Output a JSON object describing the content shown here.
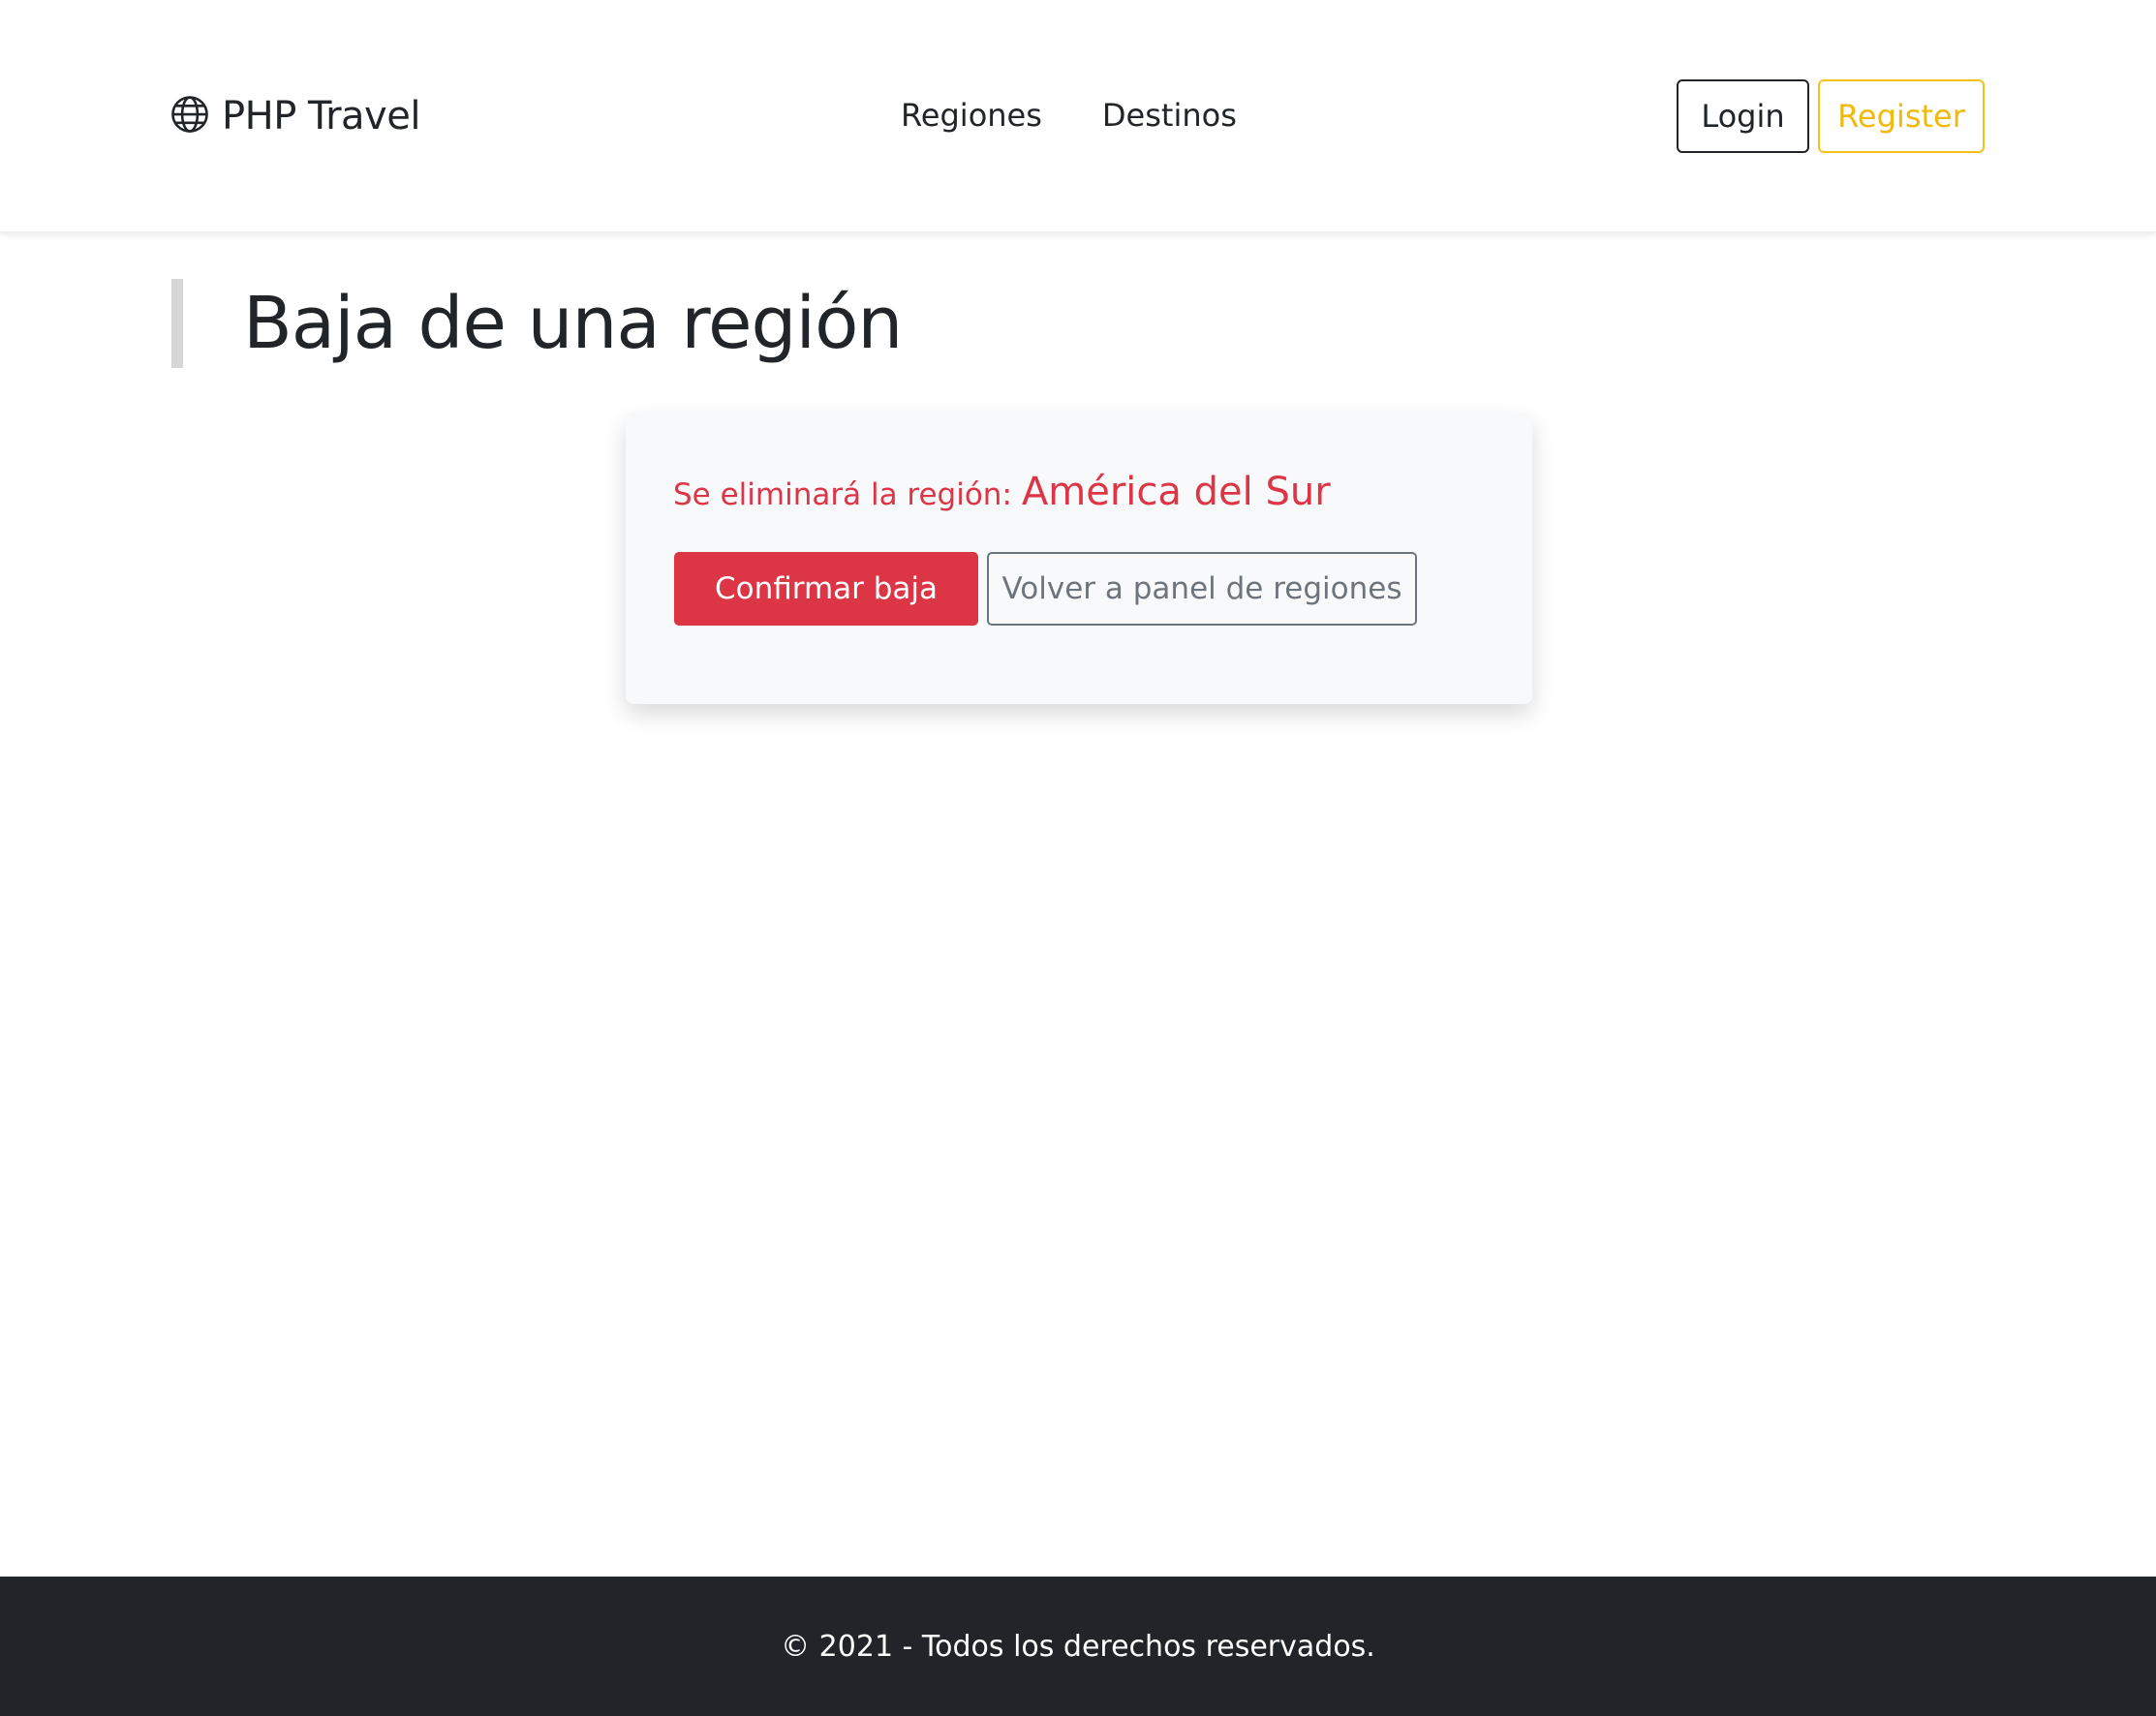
{
  "header": {
    "brand": "PHP Travel",
    "brand_icon": "globe-icon",
    "nav": [
      {
        "label": "Regiones"
      },
      {
        "label": "Destinos"
      }
    ],
    "login_label": "Login",
    "register_label": "Register"
  },
  "page": {
    "title": "Baja de una región"
  },
  "card": {
    "warning_label": "Se eliminará la región:",
    "region_name": "América del Sur",
    "confirm_label": "Confirmar baja",
    "back_label": "Volver a panel de regiones"
  },
  "footer": {
    "text": "© 2021 - Todos los derechos reservados."
  },
  "colors": {
    "danger": "#dc3545",
    "warning": "#f0b90b",
    "dark": "#212529",
    "secondary": "#6c757d"
  }
}
